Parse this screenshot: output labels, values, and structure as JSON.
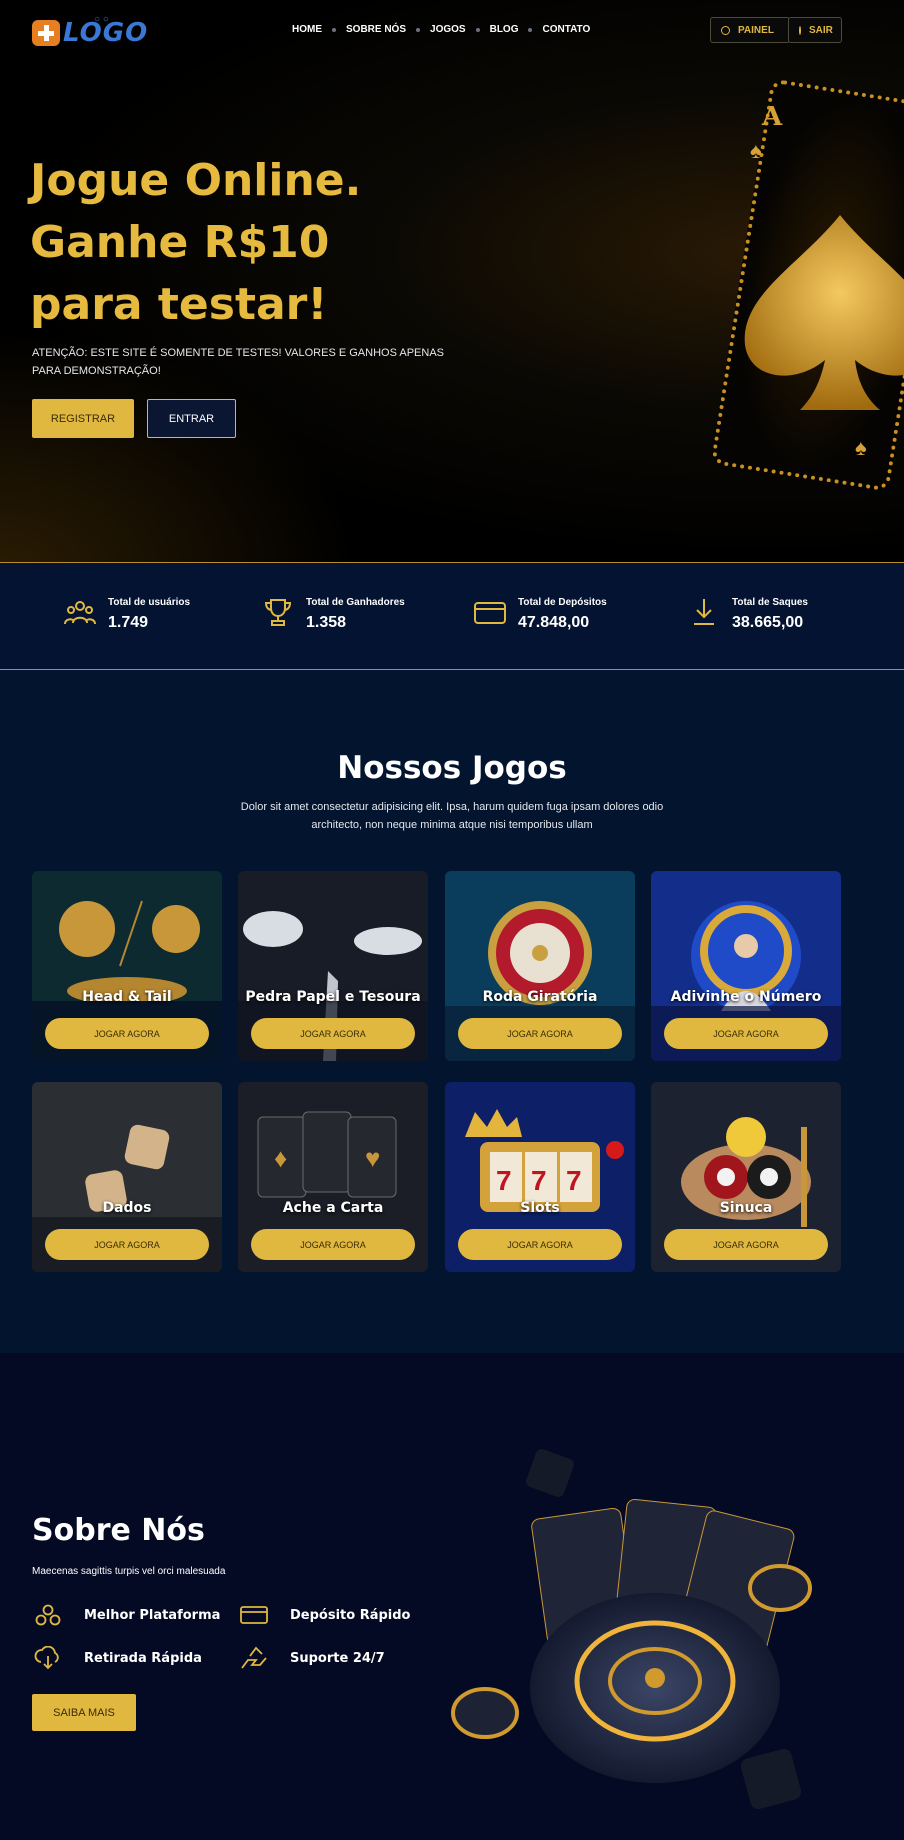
{
  "header": {
    "logo_text": "LOGO",
    "nav": [
      "HOME",
      "SOBRE NÓS",
      "JOGOS",
      "BLOG",
      "CONTATO"
    ],
    "painel_label": "PAINEL",
    "sair_label": "SAIR"
  },
  "hero": {
    "title": "Jogue Online. Ganhe R$10 para testar!",
    "subtitle": "ATENÇÃO: ESTE SITE É SOMENTE DE TESTES! VALORES E GANHOS APENAS PARA DEMONSTRAÇÃO!",
    "register_label": "REGISTRAR",
    "enter_label": "ENTRAR"
  },
  "stats": [
    {
      "label": "Total de usuários",
      "value": "1.749",
      "icon": "users-icon"
    },
    {
      "label": "Total de Ganhadores",
      "value": "1.358",
      "icon": "trophy-icon"
    },
    {
      "label": "Total de Depósitos",
      "value": "47.848,00",
      "icon": "credit-card-icon"
    },
    {
      "label": "Total de Saques",
      "value": "38.665,00",
      "icon": "download-icon"
    }
  ],
  "games": {
    "title": "Nossos Jogos",
    "description": "Dolor sit amet consectetur adipisicing elit. Ipsa, harum quidem fuga ipsam dolores odio architecto, non neque minima atque nisi temporibus ullam",
    "play_label": "JOGAR AGORA",
    "items": [
      {
        "name": "Head & Tail"
      },
      {
        "name": "Pedra Papel e Tesoura"
      },
      {
        "name": "Roda Giratória"
      },
      {
        "name": "Adivinhe o Número"
      },
      {
        "name": "Dados"
      },
      {
        "name": "Ache a Carta"
      },
      {
        "name": "Slots"
      },
      {
        "name": "Sinuca"
      }
    ]
  },
  "about": {
    "title": "Sobre Nós",
    "description": "Maecenas sagittis turpis vel orci malesuada",
    "features": [
      "Melhor Plataforma",
      "Depósito Rápido",
      "Retirada Rápida",
      "Suporte 24/7"
    ],
    "button_label": "SAIBA MAIS"
  },
  "colors": {
    "accent": "#e0b83f",
    "navy": "#03142f",
    "dark": "#040a23"
  }
}
